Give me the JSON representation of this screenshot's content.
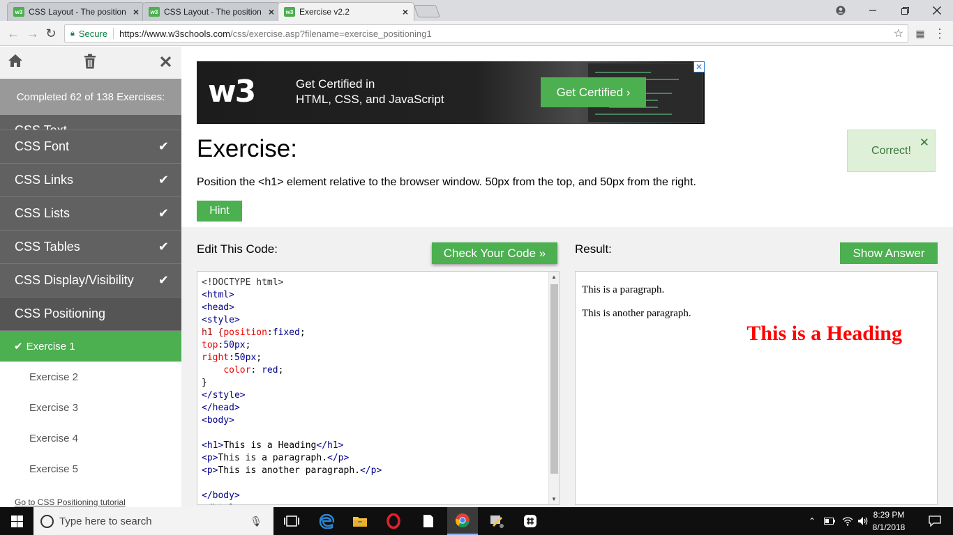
{
  "browser": {
    "tabs": [
      {
        "label": "CSS Layout - The position",
        "favicon": "w3"
      },
      {
        "label": "CSS Layout - The position",
        "favicon": "w3"
      },
      {
        "label": "Exercise v2.2",
        "favicon": "w3"
      }
    ],
    "secure_label": "Secure",
    "url_host": "https://www.w3schools.com",
    "url_path": "/css/exercise.asp?filename=exercise_positioning1"
  },
  "sidebar": {
    "completed": "Completed 62 of 138 Exercises:",
    "partial_topic": "CSS Text",
    "topics": [
      {
        "label": "CSS Font"
      },
      {
        "label": "CSS Links"
      },
      {
        "label": "CSS Lists"
      },
      {
        "label": "CSS Tables"
      },
      {
        "label": "CSS Display/Visibility"
      }
    ],
    "current_topic": "CSS Positioning",
    "exercises": [
      "Exercise 1",
      "Exercise 2",
      "Exercise 3",
      "Exercise 4",
      "Exercise 5"
    ],
    "tutorial_link": "Go to CSS Positioning tutorial"
  },
  "ad": {
    "line1": "Get Certified in",
    "line2": "HTML, CSS, and JavaScript",
    "button": "Get Certified ›"
  },
  "exercise": {
    "heading": "Exercise:",
    "instructions": "Position the <h1> element relative to the browser window. 50px from the top, and 50px from the right.",
    "hint": "Hint",
    "correct": "Correct!"
  },
  "editor": {
    "label": "Edit This Code:",
    "check_button": "Check Your Code »",
    "code": [
      {
        "t": "doc",
        "s": "<!DOCTYPE html>"
      },
      {
        "t": "tag",
        "s": "<html>"
      },
      {
        "t": "tag",
        "s": "<head>"
      },
      {
        "t": "tag",
        "s": "<style>"
      },
      {
        "t": "css",
        "parts": [
          [
            "sel",
            "h1 {"
          ],
          [
            "prop",
            "position"
          ],
          [
            "txt",
            ":"
          ],
          [
            "val",
            "fixed"
          ],
          [
            "txt",
            ";"
          ]
        ]
      },
      {
        "t": "css",
        "parts": [
          [
            "prop",
            "top"
          ],
          [
            "txt",
            ":"
          ],
          [
            "val",
            "50px"
          ],
          [
            "txt",
            ";"
          ]
        ]
      },
      {
        "t": "css",
        "parts": [
          [
            "prop",
            "right"
          ],
          [
            "txt",
            ":"
          ],
          [
            "val",
            "50px"
          ],
          [
            "txt",
            ";"
          ]
        ]
      },
      {
        "t": "css",
        "parts": [
          [
            "txt",
            "    "
          ],
          [
            "prop",
            "color"
          ],
          [
            "txt",
            ": "
          ],
          [
            "val",
            "red"
          ],
          [
            "txt",
            ";"
          ]
        ]
      },
      {
        "t": "txt",
        "s": "}"
      },
      {
        "t": "tag",
        "s": "</style>"
      },
      {
        "t": "tag",
        "s": "</head>"
      },
      {
        "t": "tag",
        "s": "<body>"
      },
      {
        "t": "txt",
        "s": ""
      },
      {
        "t": "mix",
        "parts": [
          [
            "tag",
            "<h1>"
          ],
          [
            "txt",
            "This is a Heading"
          ],
          [
            "tag",
            "</h1>"
          ]
        ]
      },
      {
        "t": "mix",
        "parts": [
          [
            "tag",
            "<p>"
          ],
          [
            "txt",
            "This is a paragraph."
          ],
          [
            "tag",
            "</p>"
          ]
        ]
      },
      {
        "t": "mix",
        "parts": [
          [
            "tag",
            "<p>"
          ],
          [
            "txt",
            "This is another paragraph."
          ],
          [
            "tag",
            "</p>"
          ]
        ]
      },
      {
        "t": "txt",
        "s": ""
      },
      {
        "t": "tag",
        "s": "</body>"
      },
      {
        "t": "tag",
        "s": "</html>"
      }
    ]
  },
  "result": {
    "label": "Result:",
    "show_button": "Show Answer",
    "p1": "This is a paragraph.",
    "p2": "This is another paragraph.",
    "h1": "This is a Heading"
  },
  "taskbar": {
    "search_placeholder": "Type here to search",
    "time": "8:29 PM",
    "date": "8/1/2018"
  },
  "colors": {
    "accent": "#4caf50",
    "sidebar": "#616161",
    "heading_result": "#ff0000"
  }
}
